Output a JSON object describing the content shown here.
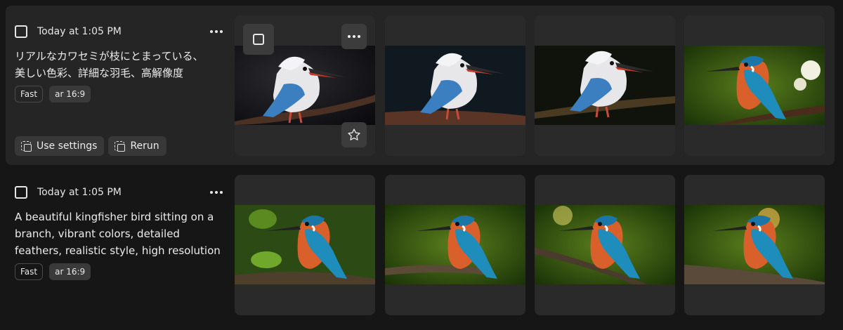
{
  "generations": [
    {
      "selected": false,
      "timestamp": "Today at 1:05 PM",
      "prompt": "リアルなカワセミが枝にとまっている、\n美しい色彩、詳細な羽毛、高解像度",
      "tags": [
        "Fast",
        "ar 16:9"
      ],
      "actions": {
        "use_settings": "Use settings",
        "rerun": "Rerun"
      },
      "images": [
        {
          "subject": "white kingfisher on branch",
          "background": "dark"
        },
        {
          "subject": "white kingfisher on branch",
          "background": "dark"
        },
        {
          "subject": "white kingfisher on mossy branch",
          "background": "dark"
        },
        {
          "subject": "orange and blue kingfisher with flowers",
          "background": "green"
        }
      ]
    },
    {
      "selected": false,
      "timestamp": "Today at 1:05 PM",
      "prompt": "A beautiful kingfisher bird sitting on a branch, vibrant colors, detailed feathers, realistic style, high resolution",
      "tags": [
        "Fast",
        "ar 16:9"
      ],
      "images": [
        {
          "subject": "kingfisher on branch",
          "background": "green leaves"
        },
        {
          "subject": "kingfisher on branch",
          "background": "green"
        },
        {
          "subject": "kingfisher on branch",
          "background": "green bokeh"
        },
        {
          "subject": "kingfisher on branch",
          "background": "green bokeh"
        }
      ]
    }
  ],
  "icons": {
    "card_select": "square-checkbox-icon",
    "card_more": "more-horizontal-icon",
    "card_favorite": "star-icon",
    "use_settings": "use-settings-icon",
    "rerun": "rerun-icon"
  },
  "colors": {
    "page_bg": "#161616",
    "selected_row_bg": "#252525",
    "card_bg": "#2a2a2a"
  }
}
